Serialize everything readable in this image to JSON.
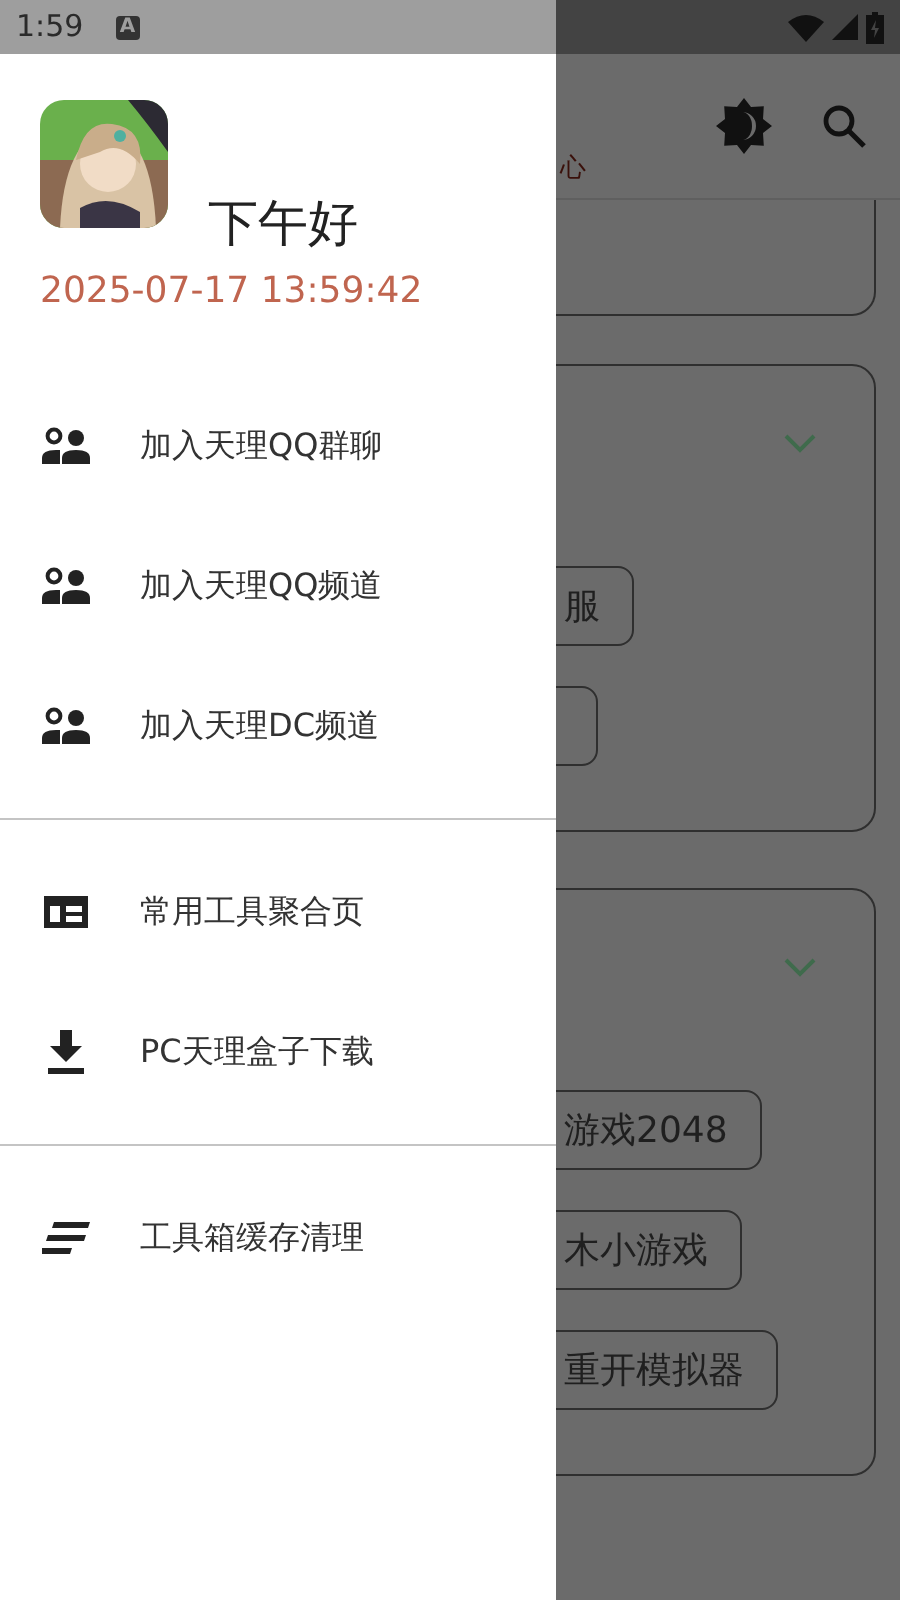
{
  "status_bar": {
    "time": "1:59",
    "notification": "A"
  },
  "app_bar": {
    "subtitle": "心"
  },
  "cards": [
    {
      "chevron": true,
      "buttons": [
        {
          "kind": "outline",
          "label": "服"
        },
        {
          "kind": "outline"
        }
      ]
    },
    {
      "chevron": true,
      "buttons": [
        {
          "kind": "outline",
          "label": "游戏2048"
        },
        {
          "kind": "outline",
          "label": "木小游戏"
        },
        {
          "kind": "outline",
          "label": "重开模拟器"
        }
      ]
    }
  ],
  "drawer": {
    "greeting": "下午好",
    "datetime": "2025-07-17 13:59:42",
    "sections": [
      [
        {
          "label": "加入天理QQ群聊"
        },
        {
          "label": "加入天理QQ频道"
        },
        {
          "label": "加入天理DC频道"
        }
      ],
      [
        {
          "label": "常用工具聚合页"
        },
        {
          "label": "PC天理盒子下载"
        }
      ],
      [
        {
          "label": "工具箱缓存清理"
        }
      ]
    ]
  }
}
